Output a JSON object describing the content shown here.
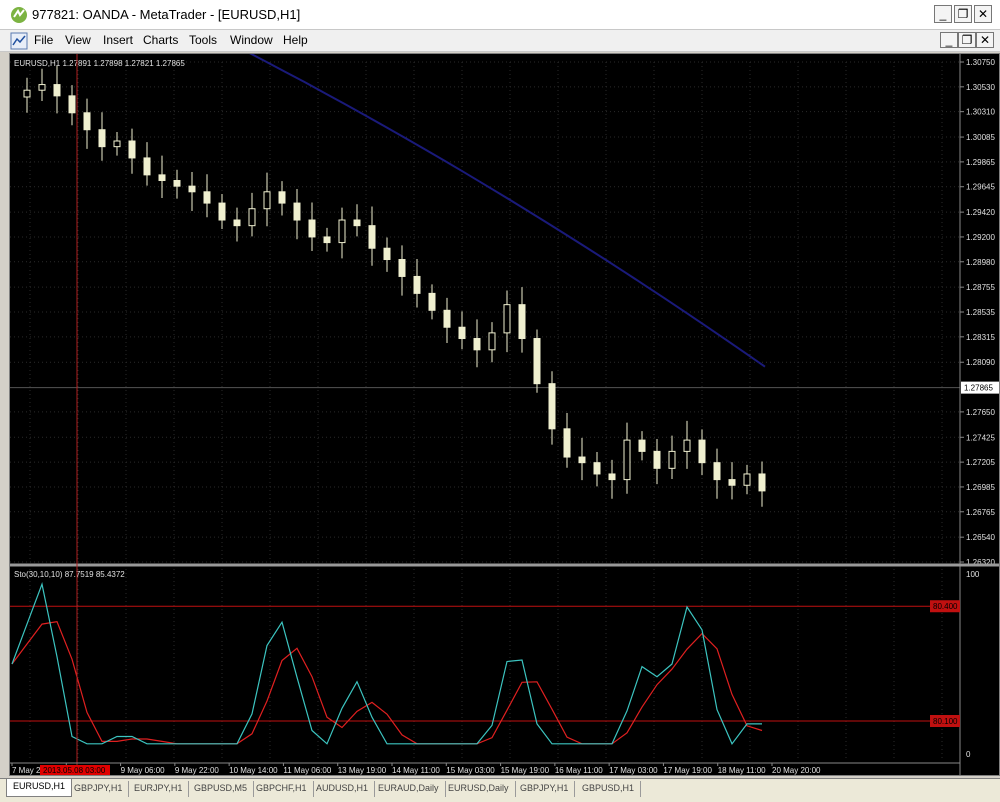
{
  "window": {
    "title": "977821: OANDA - MetaTrader - [EURUSD,H1]",
    "controls": [
      "_",
      "❐",
      "✕"
    ]
  },
  "menu": [
    "File",
    "View",
    "Insert",
    "Charts",
    "Tools",
    "Window",
    "Help"
  ],
  "chart": {
    "symbol_info": "EURUSD,H1  1.27891 1.27898 1.27821 1.27865",
    "current_price": "1.27865",
    "price_ticks": [
      "1.30750",
      "1.30530",
      "1.30310",
      "1.30085",
      "1.29865",
      "1.29645",
      "1.29420",
      "1.29200",
      "1.28980",
      "1.28755",
      "1.28535",
      "1.28315",
      "1.28090",
      "1.27650",
      "1.27425",
      "1.27205",
      "1.26985",
      "1.26765",
      "1.26540",
      "1.26320"
    ],
    "price_range": [
      1.2632,
      1.3075
    ],
    "indicator_info": "Sto(30,10,10) 87.7519 85.4372",
    "indicator_ticks": [
      "100",
      "0"
    ],
    "levels": [
      {
        "label": "80.400",
        "value": 80.4
      },
      {
        "label": "80.100",
        "value": 20
      }
    ],
    "time_ticks": [
      "7 May 2013",
      "9 May 14:00",
      "9 May 06:00",
      "9 May 22:00",
      "10 May 14:00",
      "11 May 06:00",
      "13 May 19:00",
      "14 May 11:00",
      "15 May 03:00",
      "15 May 19:00",
      "16 May 11:00",
      "17 May 03:00",
      "17 May 19:00",
      "18 May 11:00",
      "20 May 20:00"
    ],
    "crosshair_time": "2013.05.08 03:00",
    "colors": {
      "background": "#000000",
      "candles": "#f0f0d0",
      "ma": "#1a1a7a",
      "stoch_main": "#3cc4c0",
      "stoch_signal": "#e02020",
      "level": "#c01010",
      "crosshair": "#b02020"
    }
  },
  "chart_data": {
    "type": "line",
    "ylim": [
      1.2632,
      1.3075
    ],
    "x": [
      0,
      5,
      10,
      15,
      20,
      25,
      30,
      35,
      40,
      45,
      50,
      55,
      60,
      65,
      70,
      75,
      80,
      85,
      90,
      95,
      100,
      105,
      110,
      115,
      120,
      125,
      130,
      135,
      140,
      145,
      150,
      155,
      160,
      165,
      170,
      175,
      180,
      185,
      190,
      195,
      200,
      205,
      210,
      215,
      220,
      225,
      230,
      235,
      240,
      245,
      250
    ],
    "series": [
      {
        "values": [
          1.3044,
          1.305,
          1.3055,
          1.3045,
          1.303,
          1.3015,
          1.3,
          1.3005,
          1.299,
          1.2975,
          1.297,
          1.2965,
          1.296,
          1.295,
          1.2935,
          1.293,
          1.2945,
          1.296,
          1.295,
          1.2935,
          1.292,
          1.2915,
          1.2935,
          1.293,
          1.291,
          1.29,
          1.2885,
          1.287,
          1.2855,
          1.284,
          1.283,
          1.282,
          1.2835,
          1.286,
          1.283,
          1.279,
          1.275,
          1.2725,
          1.272,
          1.271,
          1.2705,
          1.274,
          1.273,
          1.2715,
          1.273,
          1.274,
          1.272,
          1.2705,
          1.27,
          1.271,
          1.2695
        ]
      }
    ]
  },
  "tabs": [
    "EURUSD,H1",
    "GBPJPY,H1",
    "EURJPY,H1",
    "GBPUSD,M5",
    "GBPCHF,H1",
    "AUDUSD,H1",
    "EURAUD,Daily",
    "EURUSD,Daily",
    "GBPJPY,H1",
    "GBPUSD,H1"
  ]
}
